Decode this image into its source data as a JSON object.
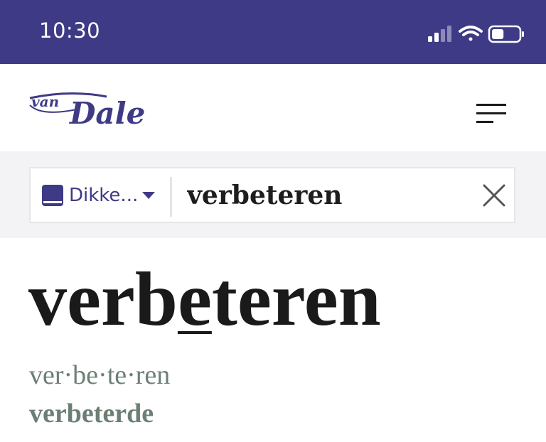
{
  "statusbar": {
    "time": "10:30",
    "signal_icon": "cellular-signal-icon",
    "wifi_icon": "wifi-icon",
    "battery_icon": "battery-icon",
    "battery_level": 0.45
  },
  "header": {
    "logo_text": "van Dale",
    "menu_icon": "hamburger-menu-icon"
  },
  "search": {
    "dictionary_label": "Dikke...",
    "dictionary_icon": "book-icon",
    "dropdown_icon": "caret-down-icon",
    "query": "verbeteren",
    "clear_icon": "close-icon"
  },
  "entry": {
    "headword_pre": "verb",
    "headword_stress": "e",
    "headword_post": "teren",
    "syllables": "ver·be·te·ren",
    "past_tense": "verbeterde"
  },
  "colors": {
    "brand": "#3f3a86",
    "muted_green": "#6c7f75",
    "search_bg": "#f3f3f5"
  }
}
